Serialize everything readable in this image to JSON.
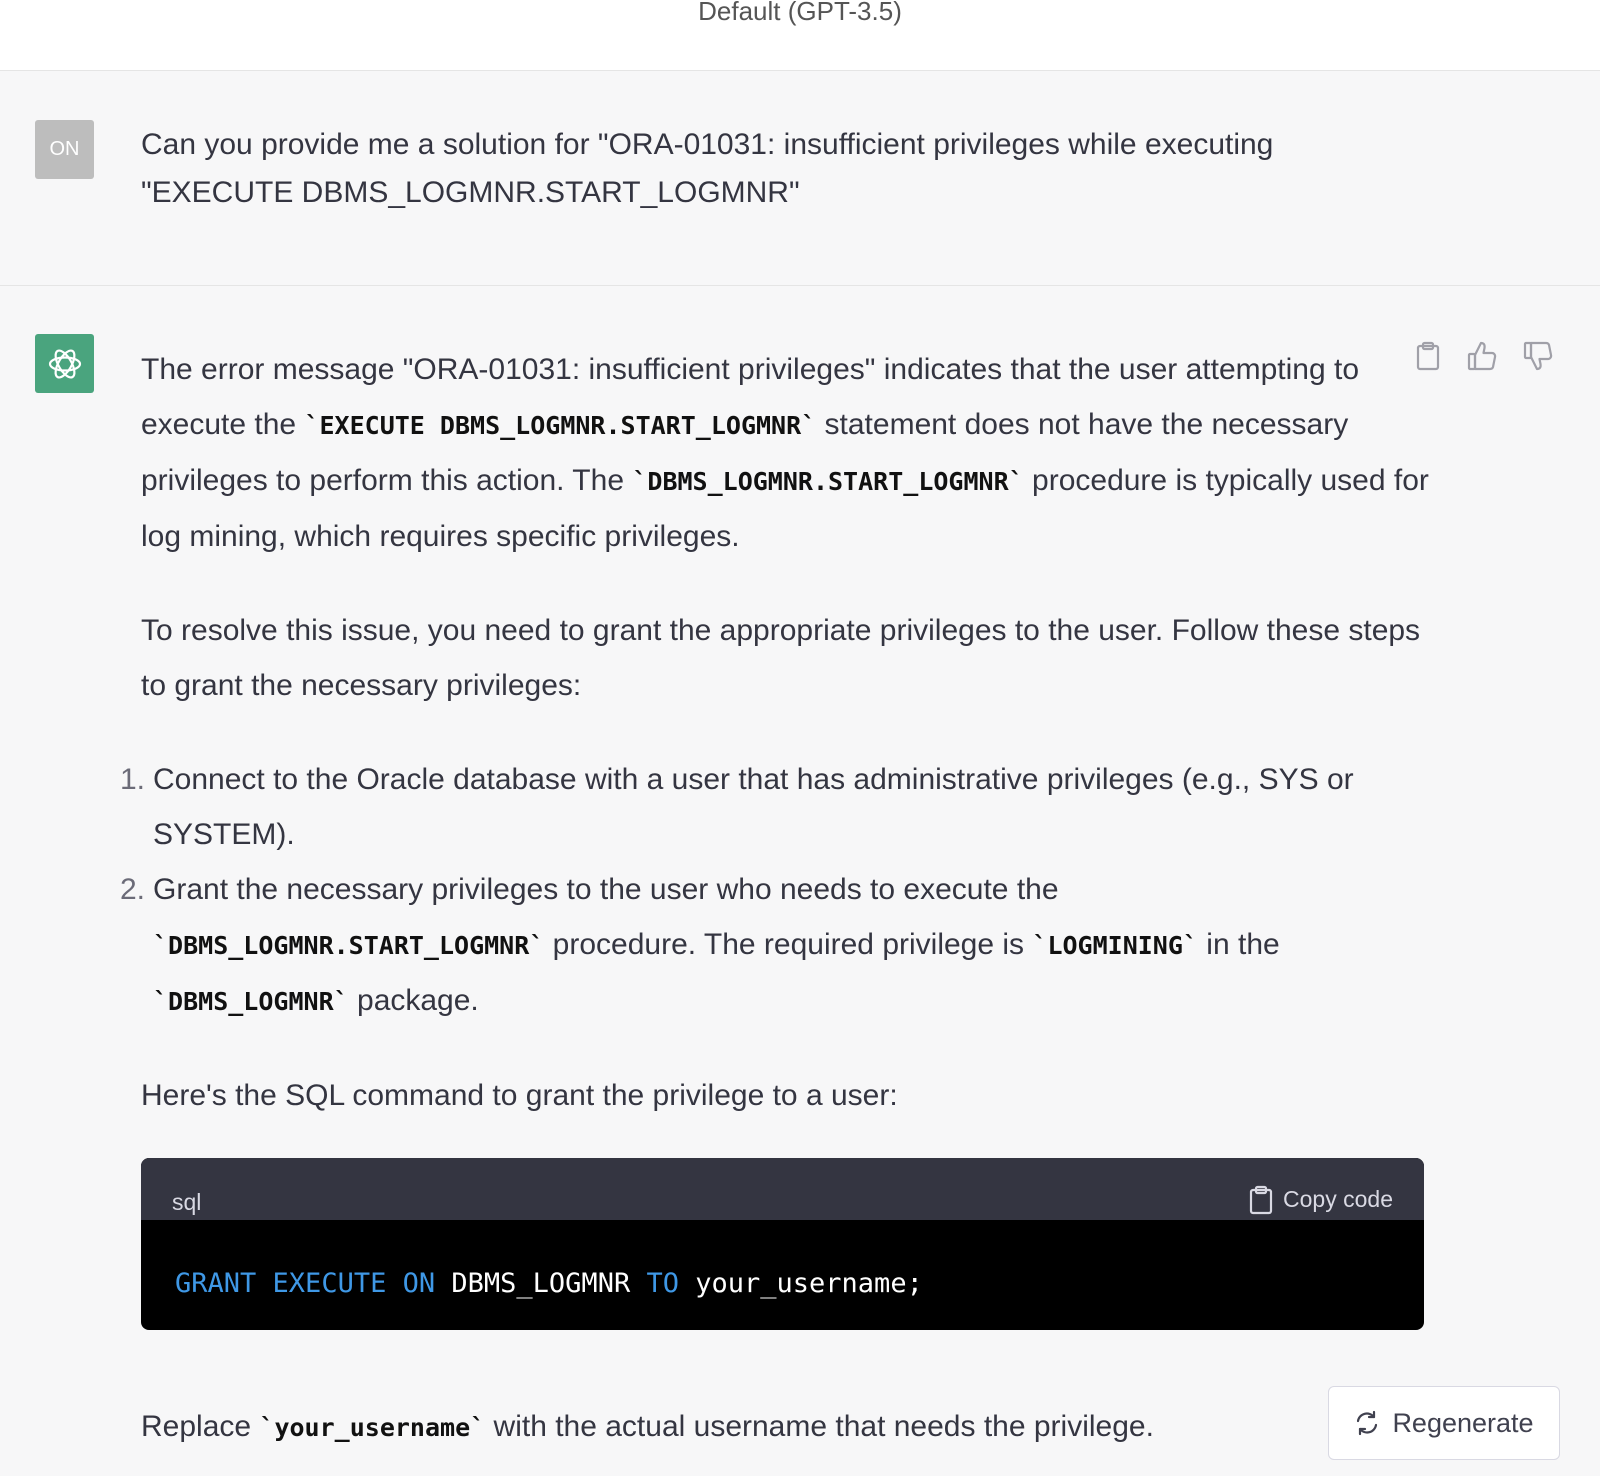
{
  "header": {
    "model_title": "Default (GPT-3.5)"
  },
  "user_message": {
    "avatar_initials": "ON",
    "text_line1": "Can you provide me a solution for \"ORA-01031: insufficient privileges while executing",
    "text_line2": "\"EXECUTE DBMS_LOGMNR.START_LOGMNR\""
  },
  "assistant_message": {
    "p1": {
      "t1": "The error message \"ORA-01031: insufficient privileges\" indicates that the user attempting to execute the ",
      "c1": "`EXECUTE DBMS_LOGMNR.START_LOGMNR`",
      "t2": " statement does not have the necessary privileges to perform this action. The ",
      "c2": "`DBMS_LOGMNR.START_LOGMNR`",
      "t3": " procedure is typically used for log mining, which requires specific privileges."
    },
    "p2": "To resolve this issue, you need to grant the appropriate privileges to the user. Follow these steps to grant the necessary privileges:",
    "steps": [
      {
        "num": "1.",
        "text": "Connect to the Oracle database with a user that has administrative privileges (e.g., SYS or SYSTEM)."
      },
      {
        "num": "2.",
        "t1": "Grant the necessary privileges to the user who needs to execute the ",
        "c1": "`DBMS_LOGMNR.START_LOGMNR`",
        "t2": " procedure. The required privilege is ",
        "c2": "`LOGMINING`",
        "t3": " in the ",
        "c3": "`DBMS_LOGMNR`",
        "t4": " package."
      }
    ],
    "code_intro": "Here's the SQL command to grant the privilege to a user:",
    "code_block": {
      "language": "sql",
      "copy_label": "Copy code",
      "tokens": {
        "grant": "GRANT",
        "execute": "EXECUTE",
        "on": "ON",
        "object": "DBMS_LOGMNR",
        "to": "TO",
        "user": "your_username;"
      }
    },
    "final": {
      "t1": "Replace ",
      "c1": "`your_username`",
      "t2": " with the actual username that needs the privilege."
    }
  },
  "regenerate_label": "Regenerate",
  "icons": {
    "copy": "clipboard-icon",
    "thumbs_up": "thumbs-up-icon",
    "thumbs_down": "thumbs-down-icon",
    "regenerate": "refresh-icon",
    "assistant_avatar": "openai-logo-icon"
  },
  "colors": {
    "assistant_avatar_bg": "#4aa47e",
    "user_avatar_bg": "#bdbdbd",
    "code_keyword": "#3f98e6",
    "code_header_bg": "#343541"
  }
}
